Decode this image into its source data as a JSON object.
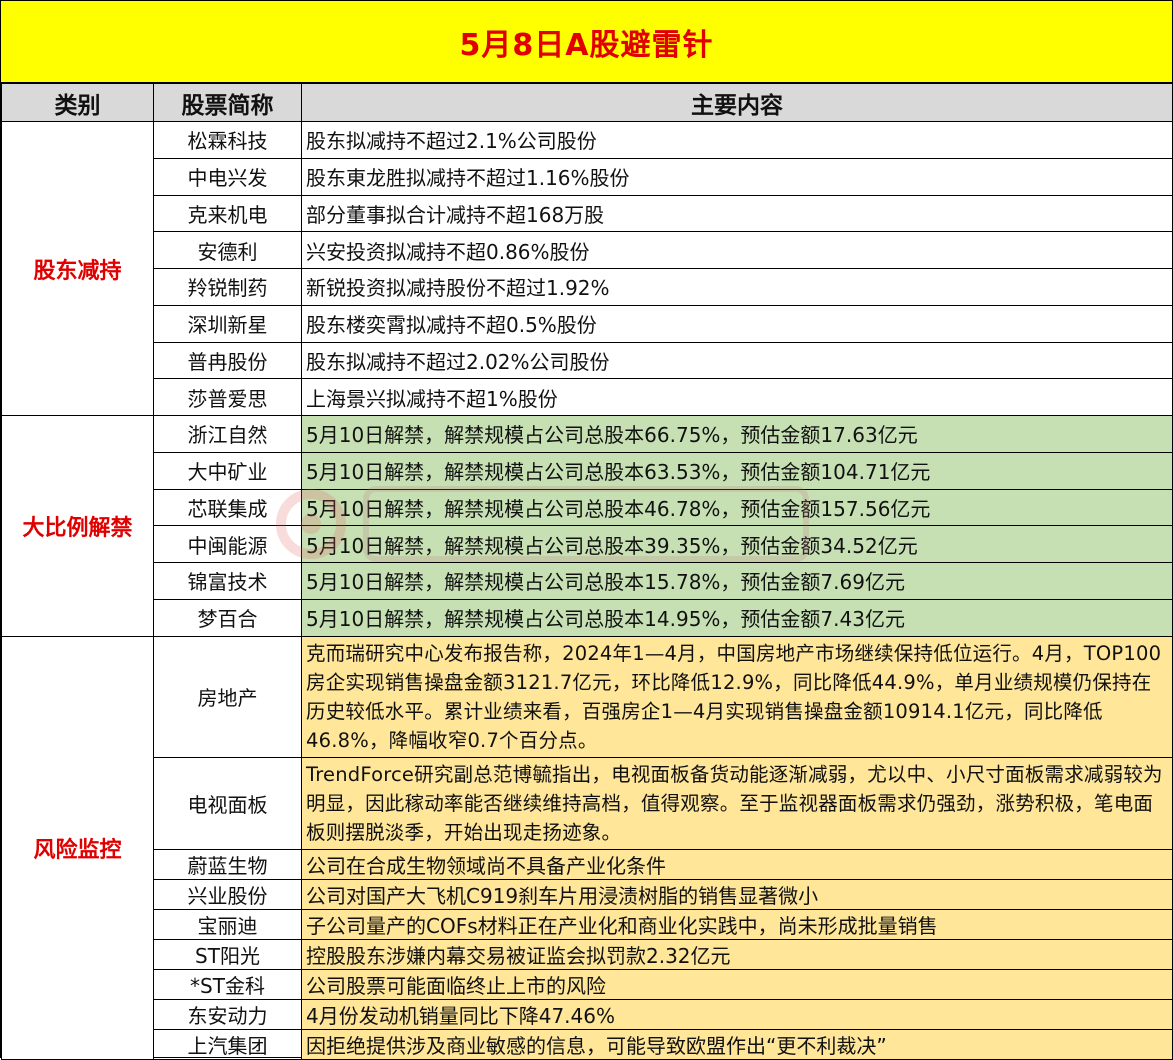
{
  "title": "5月8日A股避雷针",
  "headers": {
    "category": "类别",
    "stock": "股票简称",
    "content": "主要内容"
  },
  "colors": {
    "title_bg": "#ffff00",
    "title_text": "#e00000",
    "header_bg": "#d9d9d9",
    "unlock_bg": "#c6e0b4",
    "risk_bg": "#ffe699",
    "category_text": "#e00000"
  },
  "sections": [
    {
      "category": "股东减持",
      "rows": [
        {
          "name": "松霖科技",
          "content": "股东拟减持不超过2.1%公司股份"
        },
        {
          "name": "中电兴发",
          "content": "股东東龙胜拟减持不超过1.16%股份"
        },
        {
          "name": "克来机电",
          "content": "部分董事拟合计减持不超168万股"
        },
        {
          "name": "安德利",
          "content": "兴安投资拟减持不超0.86%股份"
        },
        {
          "name": "羚锐制药",
          "content": "新锐投资拟减持股份不超过1.92%"
        },
        {
          "name": "深圳新星",
          "content": "股东楼奕霄拟减持不超0.5%股份"
        },
        {
          "name": "普冉股份",
          "content": "股东拟减持不超过2.02%公司股份"
        },
        {
          "name": "莎普爱思",
          "content": "上海景兴拟减持不超1%股份"
        }
      ]
    },
    {
      "category": "大比例解禁",
      "rows": [
        {
          "name": "浙江自然",
          "content": "5月10日解禁，解禁规模占公司总股本66.75%，预估金额17.63亿元"
        },
        {
          "name": "大中矿业",
          "content": "5月10日解禁，解禁规模占公司总股本63.53%，预估金额104.71亿元"
        },
        {
          "name": "芯联集成",
          "content": "5月10日解禁，解禁规模占公司总股本46.78%，预估金额157.56亿元"
        },
        {
          "name": "中闽能源",
          "content": "5月10日解禁，解禁规模占公司总股本39.35%，预估金额34.52亿元"
        },
        {
          "name": "锦富技术",
          "content": "5月10日解禁，解禁规模占公司总股本15.78%，预估金额7.69亿元"
        },
        {
          "name": "梦百合",
          "content": "5月10日解禁，解禁规模占公司总股本14.95%，预估金额7.43亿元"
        }
      ]
    },
    {
      "category": "风险监控",
      "rows": [
        {
          "name": "房地产",
          "content": "克而瑞研究中心发布报告称，2024年1—4月，中国房地产市场继续保持低位运行。4月，TOP100房企实现销售操盘金额3121.7亿元，环比降低12.9%，同比降低44.9%，单月业绩规模仍保持在历史较低水平。累计业绩来看，百强房企1—4月实现销售操盘金额10914.1亿元，同比降低46.8%，降幅收窄0.7个百分点。"
        },
        {
          "name": "电视面板",
          "content": "TrendForce研究副总范博毓指出，电视面板备货动能逐渐减弱，尤以中、小尺寸面板需求减弱较为明显，因此稼动率能否继续维持高档，值得观察。至于监视器面板需求仍强劲，涨势积极，笔电面板则摆脱淡季，开始出现走扬迹象。"
        },
        {
          "name": "蔚蓝生物",
          "content": "公司在合成生物领域尚不具备产业化条件"
        },
        {
          "name": "兴业股份",
          "content": "公司对国产大飞机C919刹车片用浸渍树脂的销售显著微小"
        },
        {
          "name": "宝丽迪",
          "content": "子公司量产的COFs材料正在产业化和商业化实践中，尚未形成批量销售"
        },
        {
          "name": "ST阳光",
          "content": "控股股东涉嫌内幕交易被证监会拟罚款2.32亿元"
        },
        {
          "name": "*ST金科",
          "content": "公司股票可能面临终止上市的风险"
        },
        {
          "name": "东安动力",
          "content": "4月份发动机销量同比下降47.46%"
        },
        {
          "name": "上汽集团",
          "content": "因拒绝提供涉及商业敏感的信息，可能导致欧盟作出“更不利裁决”"
        }
      ]
    }
  ]
}
